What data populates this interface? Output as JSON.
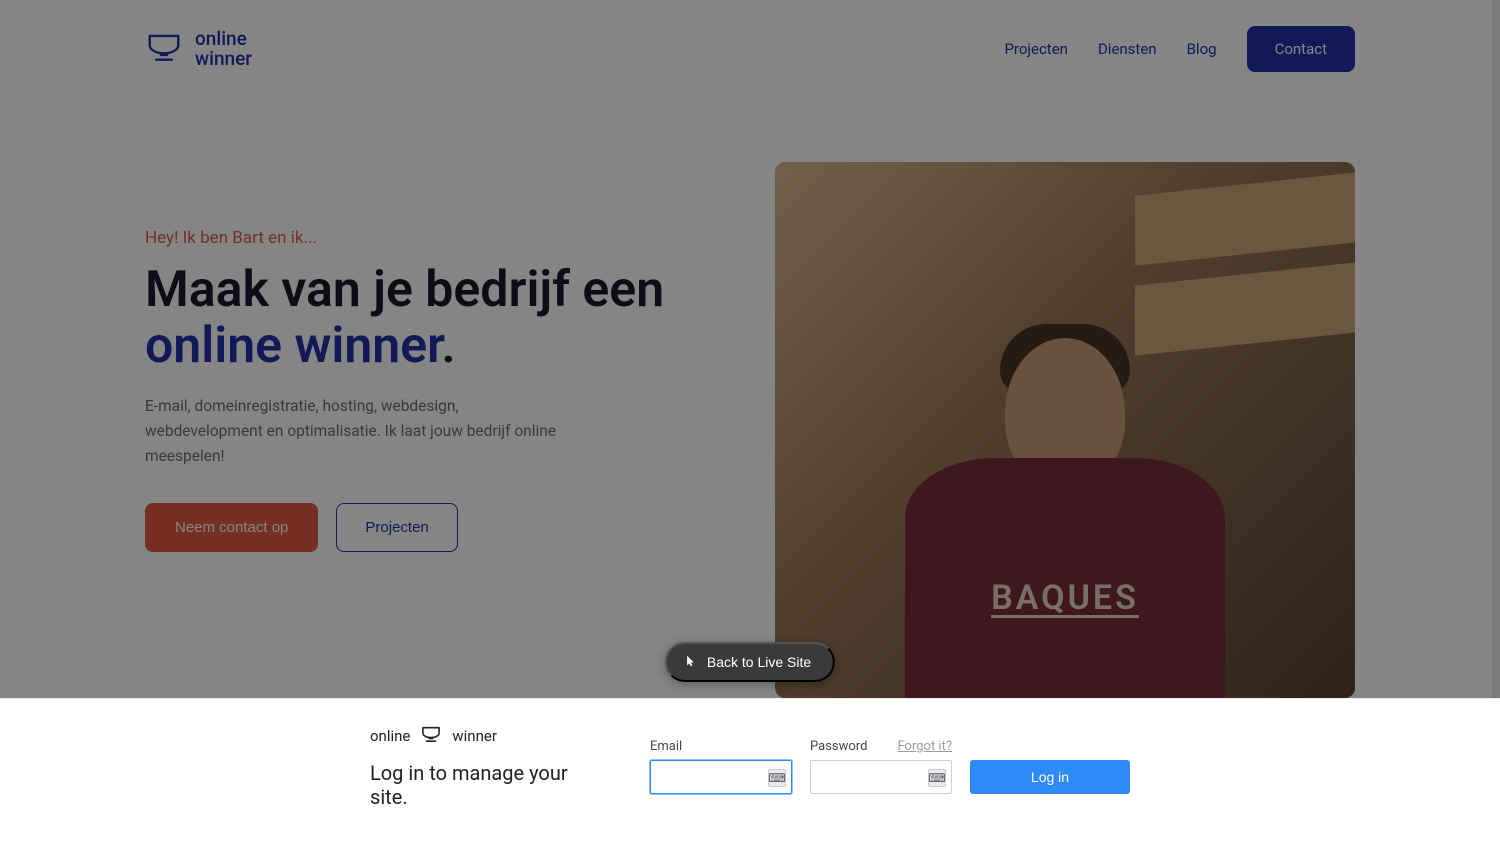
{
  "brand": {
    "line1": "online",
    "line2": "winner"
  },
  "nav": {
    "items": [
      "Projecten",
      "Diensten",
      "Blog"
    ],
    "contact": "Contact"
  },
  "hero": {
    "eyebrow": "Hey! Ik ben Bart en ik...",
    "title_plain": "Maak van je bedrijf een ",
    "title_accent": "online winner",
    "title_suffix": ".",
    "description": "E-mail, domeinregistratie, hosting, webdesign, webdevelopment en optimalisatie. Ik laat jouw bedrijf online meespelen!",
    "cta_primary": "Neem contact op",
    "cta_secondary": "Projecten",
    "shirt_text": "BAQUES"
  },
  "overlay": {
    "back_label": "Back to Live Site"
  },
  "login": {
    "logo_left": "online",
    "logo_right": "winner",
    "message": "Log in to manage your site.",
    "email_label": "Email",
    "password_label": "Password",
    "forgot": "Forgot it?",
    "submit": "Log in",
    "email_value": "",
    "password_value": ""
  },
  "colors": {
    "brand_blue": "#2431A8",
    "brand_orange": "#E05B41",
    "cta_blue": "#2e8af7"
  }
}
